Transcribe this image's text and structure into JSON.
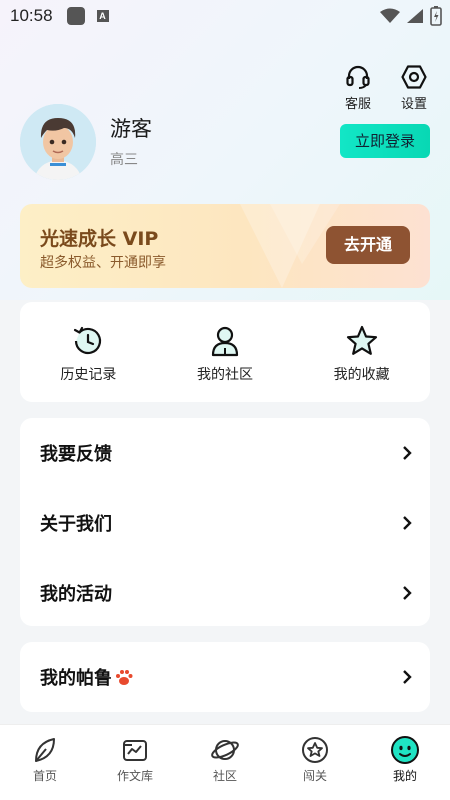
{
  "status": {
    "time": "10:58"
  },
  "header": {
    "service_label": "客服",
    "settings_label": "设置"
  },
  "profile": {
    "name": "游客",
    "grade": "高三",
    "login_label": "立即登录"
  },
  "vip": {
    "title": "光速成长 VIP",
    "subtitle": "超多权益、开通即享",
    "button_label": "去开通"
  },
  "quick_actions": [
    {
      "label": "历史记录",
      "icon": "history-icon"
    },
    {
      "label": "我的社区",
      "icon": "person-icon"
    },
    {
      "label": "我的收藏",
      "icon": "star-icon"
    }
  ],
  "menu": [
    {
      "label": "我要反馈"
    },
    {
      "label": "关于我们"
    },
    {
      "label": "我的活动"
    }
  ],
  "pet": {
    "label": "我的帕鲁"
  },
  "tabs": [
    {
      "label": "首页",
      "icon": "home-leaf-icon"
    },
    {
      "label": "作文库",
      "icon": "essay-library-icon"
    },
    {
      "label": "社区",
      "icon": "planet-icon"
    },
    {
      "label": "闯关",
      "icon": "challenge-star-icon"
    },
    {
      "label": "我的",
      "icon": "smiley-icon",
      "active": true
    }
  ],
  "colors": {
    "accent": "#0fe0c0",
    "vip_button": "#8e5332",
    "vip_text": "#7a4a1c"
  }
}
